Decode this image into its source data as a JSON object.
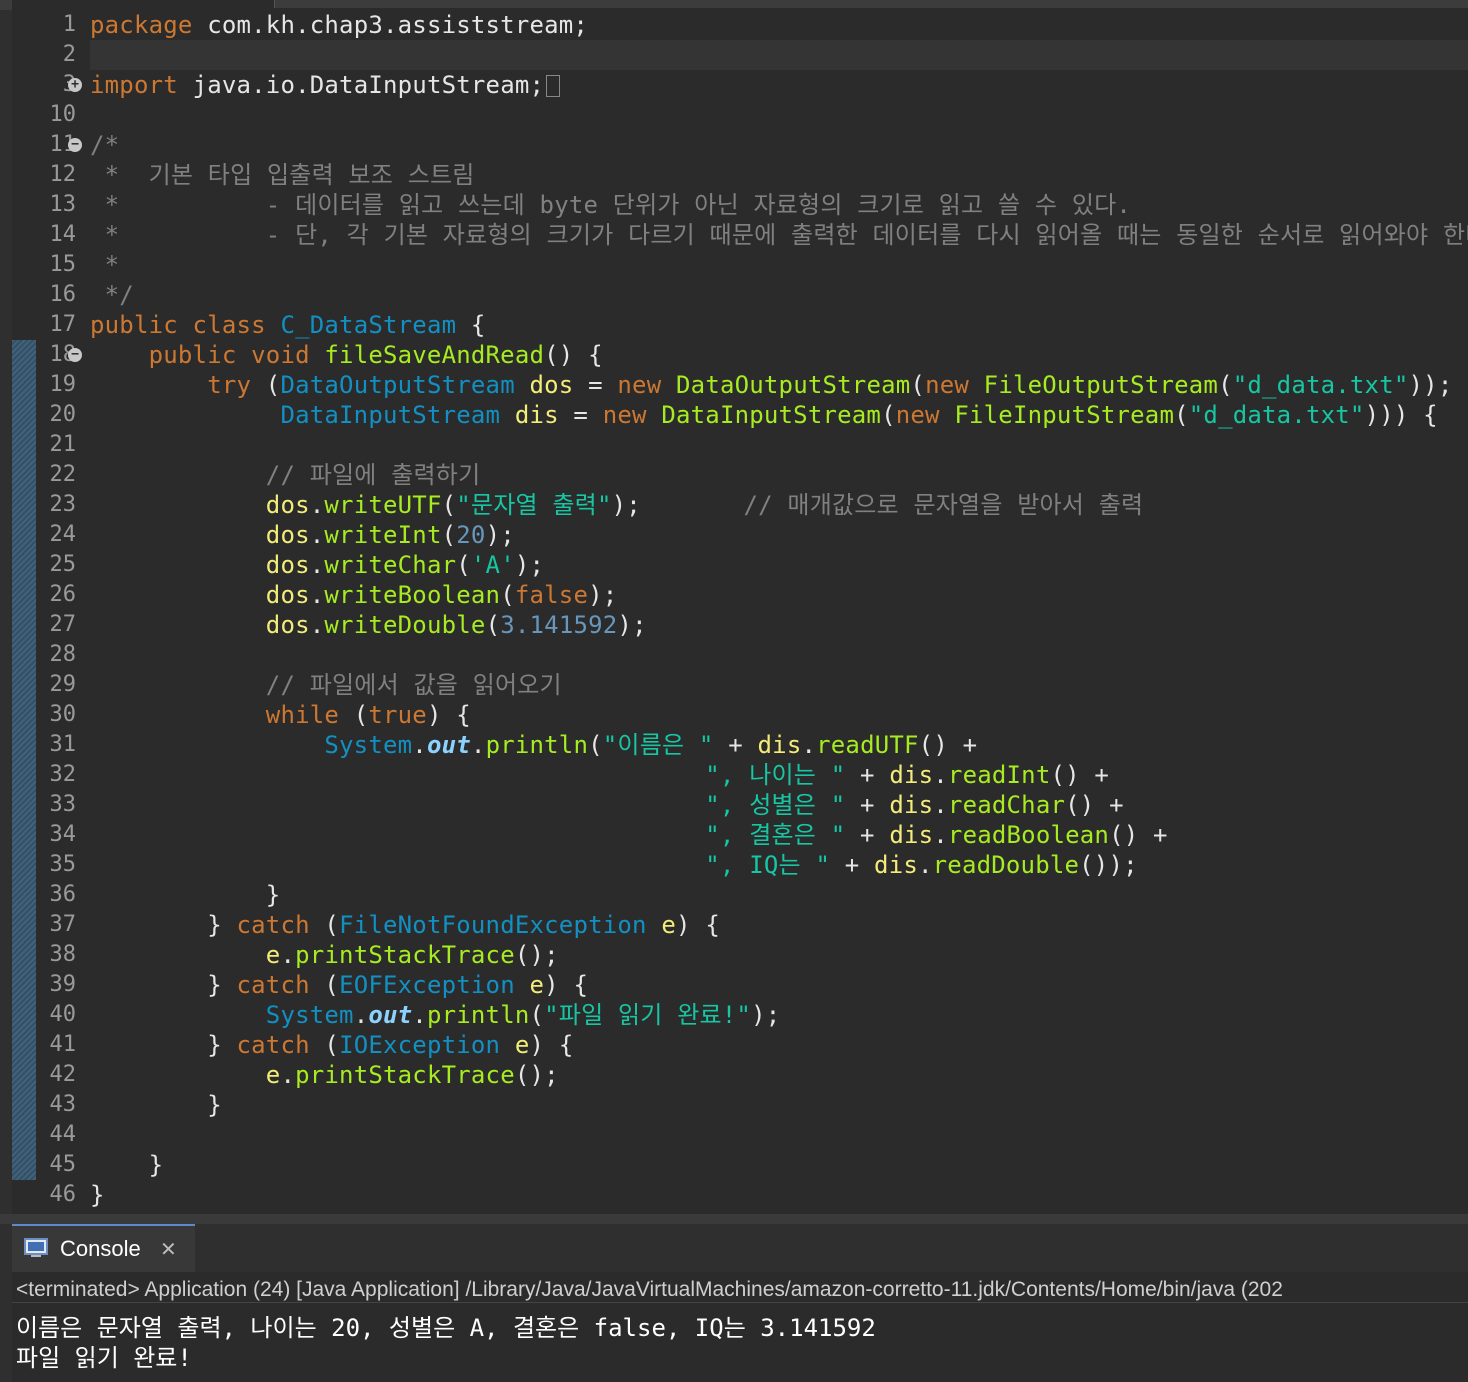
{
  "editor": {
    "lines": [
      {
        "n": "1",
        "fold": "",
        "code": [
          [
            "kw",
            "package"
          ],
          [
            "",
            "com.kh.chap3.assiststream;"
          ]
        ]
      },
      {
        "n": "2",
        "fold": "",
        "code": []
      },
      {
        "n": "3",
        "fold": "+",
        "code": [
          [
            "kw",
            "import"
          ],
          [
            "",
            "java.io.DataInputStream;"
          ],
          [
            "box",
            ""
          ]
        ]
      },
      {
        "n": "10",
        "fold": "",
        "code": []
      },
      {
        "n": "11",
        "fold": "−",
        "code": [
          [
            "cm",
            "/*"
          ]
        ]
      },
      {
        "n": "12",
        "fold": "",
        "code": [
          [
            "cm",
            " *  기본 타입 입출력 보조 스트림"
          ]
        ]
      },
      {
        "n": "13",
        "fold": "",
        "code": [
          [
            "cm",
            " *          - 데이터를 읽고 쓰는데 byte 단위가 아닌 자료형의 크기로 읽고 쓸 수 있다."
          ]
        ]
      },
      {
        "n": "14",
        "fold": "",
        "code": [
          [
            "cm",
            " *          - 단, 각 기본 자료형의 크기가 다르기 때문에 출력한 데이터를 다시 읽어올 때는 동일한 순서로 읽어와야 한다."
          ]
        ]
      },
      {
        "n": "15",
        "fold": "",
        "code": [
          [
            "cm",
            " *"
          ]
        ]
      },
      {
        "n": "16",
        "fold": "",
        "code": [
          [
            "cm",
            " */"
          ]
        ]
      },
      {
        "n": "17",
        "fold": "",
        "code": [
          [
            "kw",
            "public class "
          ],
          [
            "ty",
            "C_DataStream"
          ],
          [
            "",
            " {"
          ]
        ]
      },
      {
        "n": "18",
        "fold": "−",
        "code": [
          [
            "kw",
            "    public void "
          ],
          [
            "mt",
            "fileSaveAndRead"
          ],
          [
            "",
            "() {"
          ]
        ]
      },
      {
        "n": "19",
        "fold": "",
        "code": [
          [
            "kw",
            "        try "
          ],
          [
            "",
            "("
          ],
          [
            "ty",
            "DataOutputStream "
          ],
          [
            "vr",
            "dos"
          ],
          [
            "",
            " = "
          ],
          [
            "kw",
            "new "
          ],
          [
            "mt",
            "DataOutputStream"
          ],
          [
            "",
            "("
          ],
          [
            "kw",
            "new "
          ],
          [
            "mt",
            "FileOutputStream"
          ],
          [
            "",
            "("
          ],
          [
            "st",
            "\"d_data.txt\""
          ],
          [
            "",
            "));"
          ]
        ]
      },
      {
        "n": "20",
        "fold": "",
        "code": [
          [
            "ty",
            "             DataInputStream "
          ],
          [
            "vr",
            "dis"
          ],
          [
            "",
            " = "
          ],
          [
            "kw",
            "new "
          ],
          [
            "mt",
            "DataInputStream"
          ],
          [
            "",
            "("
          ],
          [
            "kw",
            "new "
          ],
          [
            "mt",
            "FileInputStream"
          ],
          [
            "",
            "("
          ],
          [
            "st",
            "\"d_data.txt\""
          ],
          [
            "",
            ")))"
          ],
          [
            "",
            " {"
          ]
        ]
      },
      {
        "n": "21",
        "fold": "",
        "code": []
      },
      {
        "n": "22",
        "fold": "",
        "code": [
          [
            "cm",
            "            // 파일에 출력하기"
          ]
        ]
      },
      {
        "n": "23",
        "fold": "",
        "code": [
          [
            "vr",
            "            dos"
          ],
          [
            "",
            "."
          ],
          [
            "mt",
            "writeUTF"
          ],
          [
            "",
            "("
          ],
          [
            "st",
            "\"문자열 출력\""
          ],
          [
            "",
            ");"
          ],
          [
            "cm",
            "       // 매개값으로 문자열을 받아서 출력"
          ]
        ]
      },
      {
        "n": "24",
        "fold": "",
        "code": [
          [
            "vr",
            "            dos"
          ],
          [
            "",
            "."
          ],
          [
            "mt",
            "writeInt"
          ],
          [
            "",
            "("
          ],
          [
            "nm",
            "20"
          ],
          [
            "",
            ");"
          ]
        ]
      },
      {
        "n": "25",
        "fold": "",
        "code": [
          [
            "vr",
            "            dos"
          ],
          [
            "",
            "."
          ],
          [
            "mt",
            "writeChar"
          ],
          [
            "",
            "("
          ],
          [
            "st",
            "'A'"
          ],
          [
            "",
            ");"
          ]
        ]
      },
      {
        "n": "26",
        "fold": "",
        "code": [
          [
            "vr",
            "            dos"
          ],
          [
            "",
            "."
          ],
          [
            "mt",
            "writeBoolean"
          ],
          [
            "",
            "("
          ],
          [
            "kw",
            "false"
          ],
          [
            "",
            ");"
          ]
        ]
      },
      {
        "n": "27",
        "fold": "",
        "code": [
          [
            "vr",
            "            dos"
          ],
          [
            "",
            "."
          ],
          [
            "mt",
            "writeDouble"
          ],
          [
            "",
            "("
          ],
          [
            "nm",
            "3.141592"
          ],
          [
            "",
            ");"
          ]
        ]
      },
      {
        "n": "28",
        "fold": "",
        "code": []
      },
      {
        "n": "29",
        "fold": "",
        "code": [
          [
            "cm",
            "            // 파일에서 값을 읽어오기"
          ]
        ]
      },
      {
        "n": "30",
        "fold": "",
        "code": [
          [
            "kw",
            "            while "
          ],
          [
            "",
            "("
          ],
          [
            "kw",
            "true"
          ],
          [
            "",
            ") {"
          ]
        ]
      },
      {
        "n": "31",
        "fold": "",
        "code": [
          [
            "ty",
            "                System"
          ],
          [
            "",
            "."
          ],
          [
            "fi",
            "out"
          ],
          [
            "",
            "."
          ],
          [
            "mt",
            "println"
          ],
          [
            "",
            "("
          ],
          [
            "st",
            "\"이름은 \""
          ],
          [
            "",
            " + "
          ],
          [
            "vr",
            "dis"
          ],
          [
            "",
            "."
          ],
          [
            "mt",
            "readUTF"
          ],
          [
            "",
            "() +"
          ]
        ]
      },
      {
        "n": "32",
        "fold": "",
        "code": [
          [
            "st",
            "                                          \", 나이는 \""
          ],
          [
            "",
            " + "
          ],
          [
            "vr",
            "dis"
          ],
          [
            "",
            "."
          ],
          [
            "mt",
            "readInt"
          ],
          [
            "",
            "() +"
          ]
        ]
      },
      {
        "n": "33",
        "fold": "",
        "code": [
          [
            "st",
            "                                          \", 성별은 \""
          ],
          [
            "",
            " + "
          ],
          [
            "vr",
            "dis"
          ],
          [
            "",
            "."
          ],
          [
            "mt",
            "readChar"
          ],
          [
            "",
            "() +"
          ]
        ]
      },
      {
        "n": "34",
        "fold": "",
        "code": [
          [
            "st",
            "                                          \", 결혼은 \""
          ],
          [
            "",
            " + "
          ],
          [
            "vr",
            "dis"
          ],
          [
            "",
            "."
          ],
          [
            "mt",
            "readBoolean"
          ],
          [
            "",
            "() +"
          ]
        ]
      },
      {
        "n": "35",
        "fold": "",
        "code": [
          [
            "st",
            "                                          \", IQ는 \""
          ],
          [
            "",
            " + "
          ],
          [
            "vr",
            "dis"
          ],
          [
            "",
            "."
          ],
          [
            "mt",
            "readDouble"
          ],
          [
            "",
            "());"
          ]
        ]
      },
      {
        "n": "36",
        "fold": "",
        "code": [
          [
            "",
            "            }"
          ]
        ]
      },
      {
        "n": "37",
        "fold": "",
        "code": [
          [
            "",
            "        } "
          ],
          [
            "kw",
            "catch "
          ],
          [
            "",
            "("
          ],
          [
            "ty",
            "FileNotFoundException "
          ],
          [
            "vr",
            "e"
          ],
          [
            "",
            ") {"
          ]
        ]
      },
      {
        "n": "38",
        "fold": "",
        "code": [
          [
            "vr",
            "            e"
          ],
          [
            "",
            "."
          ],
          [
            "mt",
            "printStackTrace"
          ],
          [
            "",
            "();"
          ]
        ]
      },
      {
        "n": "39",
        "fold": "",
        "code": [
          [
            "",
            "        } "
          ],
          [
            "kw",
            "catch "
          ],
          [
            "",
            "("
          ],
          [
            "ty",
            "EOFException "
          ],
          [
            "vr",
            "e"
          ],
          [
            "",
            ") {"
          ]
        ]
      },
      {
        "n": "40",
        "fold": "",
        "code": [
          [
            "ty",
            "            System"
          ],
          [
            "",
            "."
          ],
          [
            "fi",
            "out"
          ],
          [
            "",
            "."
          ],
          [
            "mt",
            "println"
          ],
          [
            "",
            "("
          ],
          [
            "st",
            "\"파일 읽기 완료!\""
          ],
          [
            "",
            ");"
          ]
        ]
      },
      {
        "n": "41",
        "fold": "",
        "code": [
          [
            "",
            "        } "
          ],
          [
            "kw",
            "catch "
          ],
          [
            "",
            "("
          ],
          [
            "ty",
            "IOException "
          ],
          [
            "vr",
            "e"
          ],
          [
            "",
            ") {"
          ]
        ]
      },
      {
        "n": "42",
        "fold": "",
        "code": [
          [
            "vr",
            "            e"
          ],
          [
            "",
            "."
          ],
          [
            "mt",
            "printStackTrace"
          ],
          [
            "",
            "();"
          ]
        ]
      },
      {
        "n": "43",
        "fold": "",
        "code": [
          [
            "",
            "        }"
          ]
        ]
      },
      {
        "n": "44",
        "fold": "",
        "code": []
      },
      {
        "n": "45",
        "fold": "",
        "code": [
          [
            "",
            "    }"
          ]
        ]
      },
      {
        "n": "46",
        "fold": "",
        "code": [
          [
            "",
            "}"
          ]
        ]
      }
    ]
  },
  "console": {
    "tab_label": "Console",
    "terminated_text": "<terminated> Application (24) [Java Application] /Library/Java/JavaVirtualMachines/amazon-corretto-11.jdk/Contents/Home/bin/java  (202",
    "output": [
      "이름은 문자열 출력, 나이는 20, 성별은 A, 결혼은 false, IQ는 3.141592",
      "파일 읽기 완료!"
    ]
  }
}
